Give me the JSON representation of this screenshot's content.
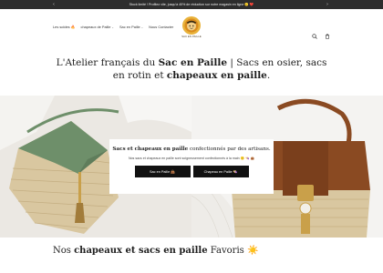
{
  "announcement": {
    "text": "Stock limité ! Profitez vite, jusqu'à 40% de réduction sur notre magasin en ligne 🙂 ❤️"
  },
  "nav": {
    "items": [
      {
        "label": "Les soldes 🔥",
        "has_dropdown": false
      },
      {
        "label": "chapeaux de Paille",
        "has_dropdown": true
      },
      {
        "label": "Sac en Paille",
        "has_dropdown": true
      },
      {
        "label": "Nous Contacter",
        "has_dropdown": false
      }
    ]
  },
  "logo": {
    "text": "SAC EN PAILLE"
  },
  "hero": {
    "part1": "L'Atelier français du ",
    "bold1": "Sac en Paille",
    "part2": " | Sacs en osier, sacs en rotin et ",
    "bold2": "chapeaux en paille",
    "part3": "."
  },
  "card": {
    "bold": "Sacs et chapeaux en paille",
    "title_rest": " confectionnés par des artisans.",
    "subtitle": "Nos sacs et chapeaux en paille sont soigneusement confectionnés à la main 🙂 👒 👜",
    "button1": "Sac en Paille 👜",
    "button2": "Chapeau en Paille 👒"
  },
  "section": {
    "part1": "Nos ",
    "bold": "chapeaux et sacs en paille",
    "part2": " Favoris ☀️"
  },
  "colors": {
    "announcement_bg": "#2d2d2d",
    "button_bg": "#111111",
    "green_leather": "#6e8f6a",
    "brown_leather": "#8a4a22",
    "straw": "#d9c7a0"
  }
}
